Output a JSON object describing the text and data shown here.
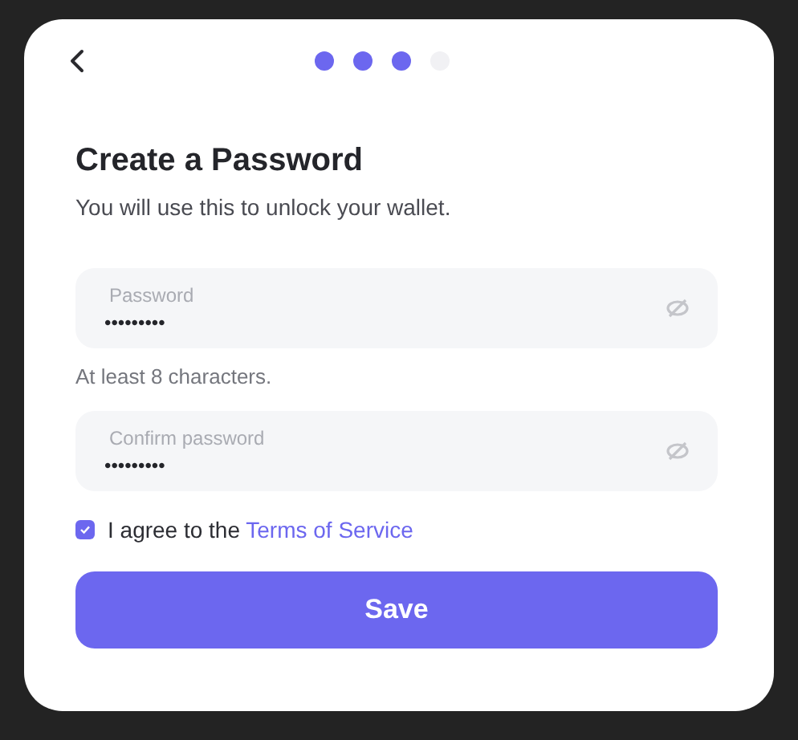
{
  "steps": [
    {
      "done": true
    },
    {
      "done": true
    },
    {
      "done": true
    },
    {
      "done": false
    }
  ],
  "title": "Create a Password",
  "subtitle": "You will use this to unlock your wallet.",
  "fields": [
    {
      "label": "Password",
      "value": "•••••••••",
      "hint": "At least 8 characters."
    },
    {
      "label": "Confirm password",
      "value": "•••••••••"
    }
  ],
  "agreement": {
    "checked": true,
    "text": "I agree to the ",
    "link": "Terms of Service"
  },
  "button": "Save"
}
